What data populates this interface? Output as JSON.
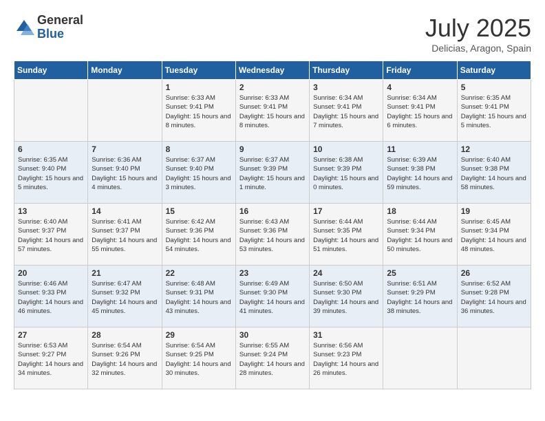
{
  "header": {
    "logo_general": "General",
    "logo_blue": "Blue",
    "month": "July 2025",
    "location": "Delicias, Aragon, Spain"
  },
  "weekdays": [
    "Sunday",
    "Monday",
    "Tuesday",
    "Wednesday",
    "Thursday",
    "Friday",
    "Saturday"
  ],
  "weeks": [
    [
      {
        "day": "",
        "text": ""
      },
      {
        "day": "",
        "text": ""
      },
      {
        "day": "1",
        "text": "Sunrise: 6:33 AM\nSunset: 9:41 PM\nDaylight: 15 hours and 8 minutes."
      },
      {
        "day": "2",
        "text": "Sunrise: 6:33 AM\nSunset: 9:41 PM\nDaylight: 15 hours and 8 minutes."
      },
      {
        "day": "3",
        "text": "Sunrise: 6:34 AM\nSunset: 9:41 PM\nDaylight: 15 hours and 7 minutes."
      },
      {
        "day": "4",
        "text": "Sunrise: 6:34 AM\nSunset: 9:41 PM\nDaylight: 15 hours and 6 minutes."
      },
      {
        "day": "5",
        "text": "Sunrise: 6:35 AM\nSunset: 9:41 PM\nDaylight: 15 hours and 5 minutes."
      }
    ],
    [
      {
        "day": "6",
        "text": "Sunrise: 6:35 AM\nSunset: 9:40 PM\nDaylight: 15 hours and 5 minutes."
      },
      {
        "day": "7",
        "text": "Sunrise: 6:36 AM\nSunset: 9:40 PM\nDaylight: 15 hours and 4 minutes."
      },
      {
        "day": "8",
        "text": "Sunrise: 6:37 AM\nSunset: 9:40 PM\nDaylight: 15 hours and 3 minutes."
      },
      {
        "day": "9",
        "text": "Sunrise: 6:37 AM\nSunset: 9:39 PM\nDaylight: 15 hours and 1 minute."
      },
      {
        "day": "10",
        "text": "Sunrise: 6:38 AM\nSunset: 9:39 PM\nDaylight: 15 hours and 0 minutes."
      },
      {
        "day": "11",
        "text": "Sunrise: 6:39 AM\nSunset: 9:38 PM\nDaylight: 14 hours and 59 minutes."
      },
      {
        "day": "12",
        "text": "Sunrise: 6:40 AM\nSunset: 9:38 PM\nDaylight: 14 hours and 58 minutes."
      }
    ],
    [
      {
        "day": "13",
        "text": "Sunrise: 6:40 AM\nSunset: 9:37 PM\nDaylight: 14 hours and 57 minutes."
      },
      {
        "day": "14",
        "text": "Sunrise: 6:41 AM\nSunset: 9:37 PM\nDaylight: 14 hours and 55 minutes."
      },
      {
        "day": "15",
        "text": "Sunrise: 6:42 AM\nSunset: 9:36 PM\nDaylight: 14 hours and 54 minutes."
      },
      {
        "day": "16",
        "text": "Sunrise: 6:43 AM\nSunset: 9:36 PM\nDaylight: 14 hours and 53 minutes."
      },
      {
        "day": "17",
        "text": "Sunrise: 6:44 AM\nSunset: 9:35 PM\nDaylight: 14 hours and 51 minutes."
      },
      {
        "day": "18",
        "text": "Sunrise: 6:44 AM\nSunset: 9:34 PM\nDaylight: 14 hours and 50 minutes."
      },
      {
        "day": "19",
        "text": "Sunrise: 6:45 AM\nSunset: 9:34 PM\nDaylight: 14 hours and 48 minutes."
      }
    ],
    [
      {
        "day": "20",
        "text": "Sunrise: 6:46 AM\nSunset: 9:33 PM\nDaylight: 14 hours and 46 minutes."
      },
      {
        "day": "21",
        "text": "Sunrise: 6:47 AM\nSunset: 9:32 PM\nDaylight: 14 hours and 45 minutes."
      },
      {
        "day": "22",
        "text": "Sunrise: 6:48 AM\nSunset: 9:31 PM\nDaylight: 14 hours and 43 minutes."
      },
      {
        "day": "23",
        "text": "Sunrise: 6:49 AM\nSunset: 9:30 PM\nDaylight: 14 hours and 41 minutes."
      },
      {
        "day": "24",
        "text": "Sunrise: 6:50 AM\nSunset: 9:30 PM\nDaylight: 14 hours and 39 minutes."
      },
      {
        "day": "25",
        "text": "Sunrise: 6:51 AM\nSunset: 9:29 PM\nDaylight: 14 hours and 38 minutes."
      },
      {
        "day": "26",
        "text": "Sunrise: 6:52 AM\nSunset: 9:28 PM\nDaylight: 14 hours and 36 minutes."
      }
    ],
    [
      {
        "day": "27",
        "text": "Sunrise: 6:53 AM\nSunset: 9:27 PM\nDaylight: 14 hours and 34 minutes."
      },
      {
        "day": "28",
        "text": "Sunrise: 6:54 AM\nSunset: 9:26 PM\nDaylight: 14 hours and 32 minutes."
      },
      {
        "day": "29",
        "text": "Sunrise: 6:54 AM\nSunset: 9:25 PM\nDaylight: 14 hours and 30 minutes."
      },
      {
        "day": "30",
        "text": "Sunrise: 6:55 AM\nSunset: 9:24 PM\nDaylight: 14 hours and 28 minutes."
      },
      {
        "day": "31",
        "text": "Sunrise: 6:56 AM\nSunset: 9:23 PM\nDaylight: 14 hours and 26 minutes."
      },
      {
        "day": "",
        "text": ""
      },
      {
        "day": "",
        "text": ""
      }
    ]
  ]
}
